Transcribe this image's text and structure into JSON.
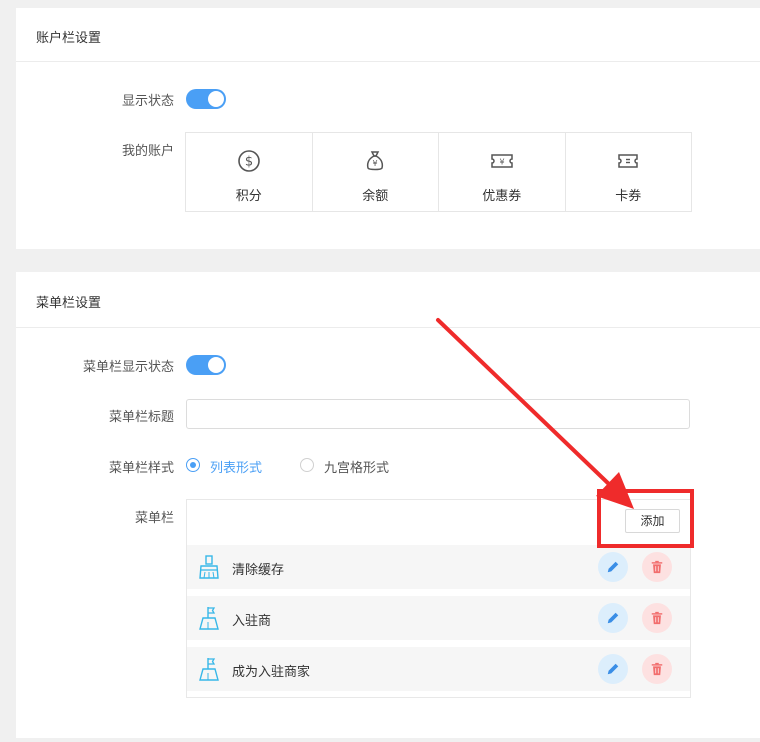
{
  "account_section": {
    "title": "账户栏设置",
    "display_label": "显示状态",
    "display_on": true,
    "my_account_label": "我的账户",
    "items": [
      {
        "label": "积分",
        "icon": "dollar-circle-icon"
      },
      {
        "label": "余额",
        "icon": "money-bag-icon"
      },
      {
        "label": "优惠券",
        "icon": "coupon-icon"
      },
      {
        "label": "卡券",
        "icon": "card-ticket-icon"
      }
    ]
  },
  "menu_section": {
    "title": "菜单栏设置",
    "display_label": "菜单栏显示状态",
    "display_on": true,
    "title_label": "菜单栏标题",
    "title_value": "",
    "style_label": "菜单栏样式",
    "style_options": [
      {
        "label": "列表形式",
        "selected": true
      },
      {
        "label": "九宫格形式",
        "selected": false
      }
    ],
    "menu_label": "菜单栏",
    "add_button": "添加",
    "items": [
      {
        "label": "清除缓存",
        "icon": "broom-icon"
      },
      {
        "label": "入驻商",
        "icon": "flag-building-icon"
      },
      {
        "label": "成为入驻商家",
        "icon": "flag-building-icon"
      }
    ]
  },
  "colors": {
    "accent": "#4a9ff5",
    "annotation_red": "#ef2b2b",
    "delete_red": "#f26d6d"
  }
}
